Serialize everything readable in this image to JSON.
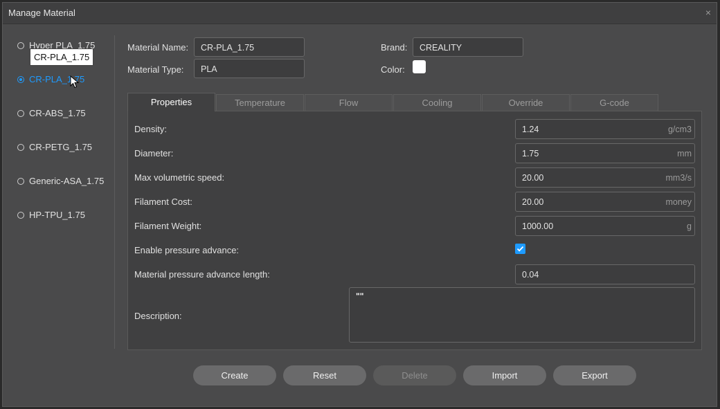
{
  "window": {
    "title": "Manage Material",
    "close_glyph": "×"
  },
  "materials": [
    {
      "label": "Hyper PLA_1.75",
      "selected": false
    },
    {
      "label": "CR-PLA_1.75",
      "selected": true
    },
    {
      "label": "CR-ABS_1.75",
      "selected": false
    },
    {
      "label": "CR-PETG_1.75",
      "selected": false
    },
    {
      "label": "Generic-ASA_1.75",
      "selected": false
    },
    {
      "label": "HP-TPU_1.75",
      "selected": false
    }
  ],
  "tooltip": "CR-PLA_1.75",
  "form": {
    "name_label": "Material Name:",
    "name_value": "CR-PLA_1.75",
    "type_label": "Material Type:",
    "type_value": "PLA",
    "brand_label": "Brand:",
    "brand_value": "CREALITY",
    "color_label": "Color:",
    "color_value": "#ffffff"
  },
  "tabs": [
    {
      "label": "Properties",
      "active": true
    },
    {
      "label": "Temperature",
      "active": false
    },
    {
      "label": "Flow",
      "active": false
    },
    {
      "label": "Cooling",
      "active": false
    },
    {
      "label": "Override",
      "active": false
    },
    {
      "label": "G-code",
      "active": false
    }
  ],
  "properties": {
    "density": {
      "label": "Density:",
      "value": "1.24",
      "unit": "g/cm3"
    },
    "diameter": {
      "label": "Diameter:",
      "value": "1.75",
      "unit": "mm"
    },
    "max_speed": {
      "label": "Max volumetric speed:",
      "value": "20.00",
      "unit": "mm3/s"
    },
    "cost": {
      "label": "Filament Cost:",
      "value": "20.00",
      "unit": "money"
    },
    "weight": {
      "label": "Filament Weight:",
      "value": "1000.00",
      "unit": "g"
    },
    "pressure_adv": {
      "label": "Enable pressure advance:",
      "checked": true
    },
    "pa_length": {
      "label": "Material pressure advance length:",
      "value": "0.04"
    },
    "description": {
      "label": "Description:",
      "value": "\"\""
    }
  },
  "buttons": {
    "create": "Create",
    "reset": "Reset",
    "delete": "Delete",
    "import": "Import",
    "export": "Export"
  },
  "colors": {
    "accent": "#1e9bff",
    "dialog_bg": "#4a4a4b",
    "panel_bg": "#404041"
  }
}
